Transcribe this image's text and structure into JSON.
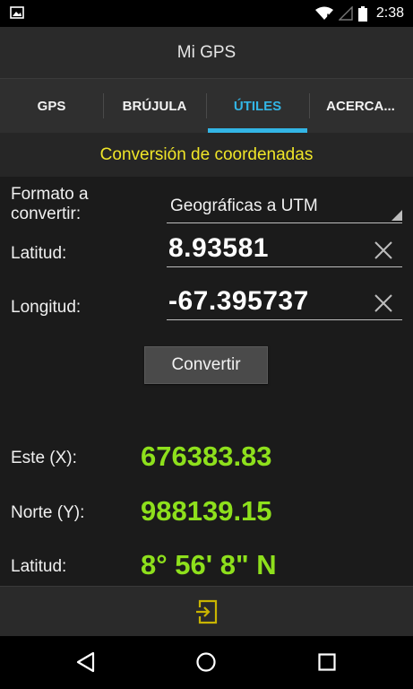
{
  "status_bar": {
    "time": "2:38"
  },
  "app": {
    "title": "Mi GPS"
  },
  "tabs": [
    {
      "label": "GPS"
    },
    {
      "label": "BRÚJULA"
    },
    {
      "label": "ÚTILES"
    },
    {
      "label": "ACERCA..."
    }
  ],
  "active_tab": "ÚTILES",
  "section": {
    "title": "Conversión de coordenadas"
  },
  "form": {
    "format_label": "Formato a convertir:",
    "format_value": "Geográficas a UTM",
    "lat_label": "Latitud:",
    "lat_value": "8.93581",
    "lon_label": "Longitud:",
    "lon_value": "-67.395737",
    "convert_label": "Convertir"
  },
  "results": {
    "east_label": "Este (X):",
    "east_value": "676383.83",
    "north_label": "Norte (Y):",
    "north_value": "988139.15",
    "lat_label": "Latitud:",
    "lat_value": "8° 56' 8\" N"
  },
  "icons": [
    "image-icon",
    "wifi-icon",
    "signal-icon",
    "battery-icon",
    "clear-icon",
    "exit-icon",
    "back-icon",
    "home-icon",
    "recents-icon"
  ],
  "colors": {
    "accent": "#33b5e5",
    "section_title": "#f0e628",
    "result": "#8ee01c",
    "exit_icon": "#c8b400"
  }
}
